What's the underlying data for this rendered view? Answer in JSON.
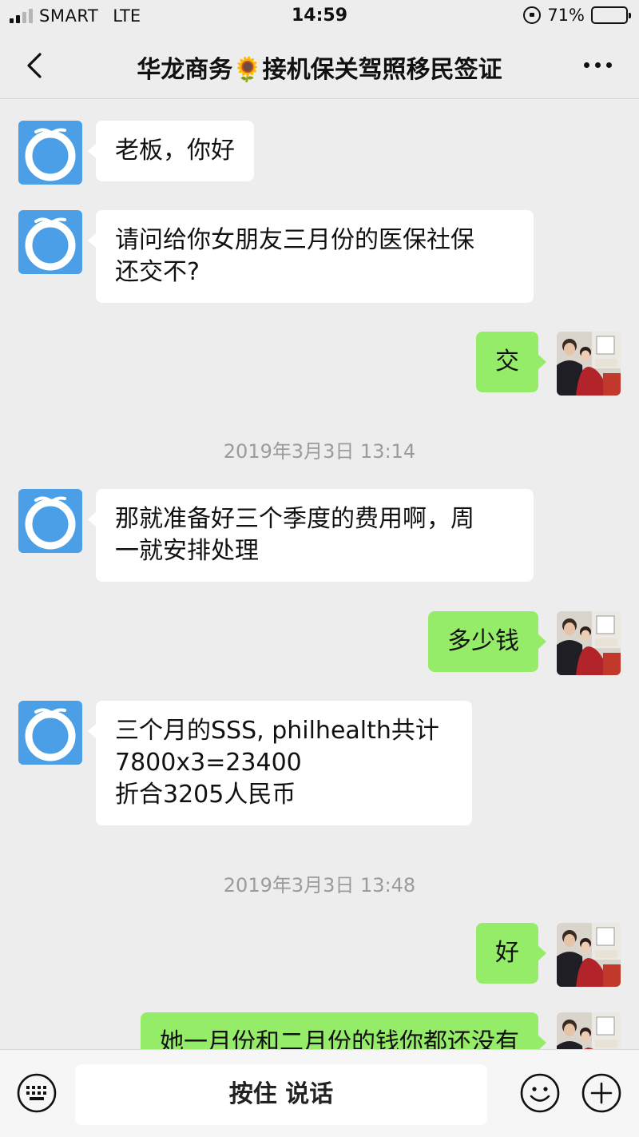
{
  "status_bar": {
    "carrier": "SMART",
    "network": "LTE",
    "time": "14:59",
    "battery": "71%",
    "battery_level": 0.71
  },
  "header": {
    "title": "华龙商务🌻接机保关驾照移民签证"
  },
  "messages": [
    {
      "from": "contact",
      "text": "老板，你好"
    },
    {
      "from": "contact",
      "text": "请问给你女朋友三月份的医保社保\n还交不?"
    },
    {
      "from": "me",
      "text": "交"
    },
    {
      "type": "time",
      "text": "2019年3月3日 13:14"
    },
    {
      "from": "contact",
      "text": "那就准备好三个季度的费用啊，周\n一就安排处理"
    },
    {
      "from": "me",
      "text": "多少钱"
    },
    {
      "from": "contact",
      "text": "三个月的SSS, philhealth共计\n7800x3=23400\n折合3205人民币"
    },
    {
      "type": "time",
      "text": "2019年3月3日 13:48"
    },
    {
      "from": "me",
      "text": "好"
    },
    {
      "from": "me",
      "text": "她一月份和二月份的钱你都还没有"
    }
  ],
  "input_bar": {
    "hold_to_talk": "按住 说话"
  },
  "colors": {
    "background": "#ededed",
    "outgoing_bubble": "#95ec69",
    "incoming_bubble": "#ffffff",
    "contact_avatar": "#4a9fe6"
  }
}
